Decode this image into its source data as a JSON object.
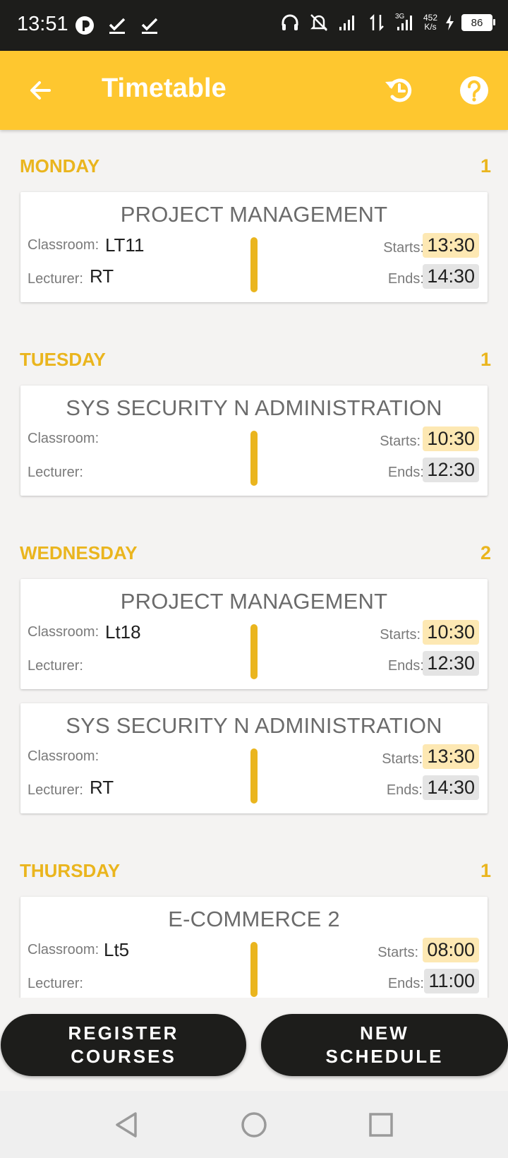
{
  "status_bar": {
    "time": "13:51",
    "network_speed_value": "452",
    "network_speed_unit": "K/s",
    "network_type": "3G",
    "battery": "86",
    "icons": [
      "app-notification-icon",
      "check-icon",
      "check-icon",
      "headset-icon",
      "bell-off-icon",
      "signal-icon",
      "data-arrows-icon",
      "signal-3g-icon",
      "charging-icon",
      "battery-icon"
    ]
  },
  "app_bar": {
    "title": "Timetable",
    "color": "#fec72f",
    "back_icon": "arrow-left-icon",
    "refresh_icon": "refresh-icon",
    "help_icon": "help-icon"
  },
  "labels": {
    "classroom": "Classroom:",
    "lecturer": "Lecturer:",
    "starts": "Starts:",
    "ends": "Ends:"
  },
  "days": [
    {
      "name": "MONDAY",
      "count": "1",
      "classes": [
        {
          "course": "PROJECT MANAGEMENT",
          "classroom": "LT11",
          "lecturer": "RT",
          "starts": "13:30",
          "ends": "14:30"
        }
      ]
    },
    {
      "name": "TUESDAY",
      "count": "1",
      "classes": [
        {
          "course": "SYS SECURITY N ADMINISTRATION",
          "classroom": "",
          "lecturer": "",
          "starts": "10:30",
          "ends": "12:30"
        }
      ]
    },
    {
      "name": "WEDNESDAY",
      "count": "2",
      "classes": [
        {
          "course": "PROJECT MANAGEMENT",
          "classroom": "Lt18",
          "lecturer": "",
          "starts": "10:30",
          "ends": "12:30"
        },
        {
          "course": "SYS SECURITY N ADMINISTRATION",
          "classroom": "",
          "lecturer": "RT",
          "starts": "13:30",
          "ends": "14:30"
        }
      ]
    },
    {
      "name": "THURSDAY",
      "count": "1",
      "classes": [
        {
          "course": "E-COMMERCE 2",
          "classroom": "Lt5",
          "lecturer": "",
          "starts": "08:00",
          "ends": "11:00"
        }
      ]
    }
  ],
  "buttons": {
    "register_line1": "REGISTER",
    "register_line2": "COURSES",
    "schedule_line1": "NEW",
    "schedule_line2": "SCHEDULE"
  },
  "nav_bar": {
    "icons": [
      "back-triangle-icon",
      "home-circle-icon",
      "recents-square-icon"
    ]
  },
  "colors": {
    "accent": "#eab51e",
    "start_highlight": "#fde8b3",
    "end_highlight": "#e4e4e4",
    "button_bg": "#1d1d1b"
  }
}
